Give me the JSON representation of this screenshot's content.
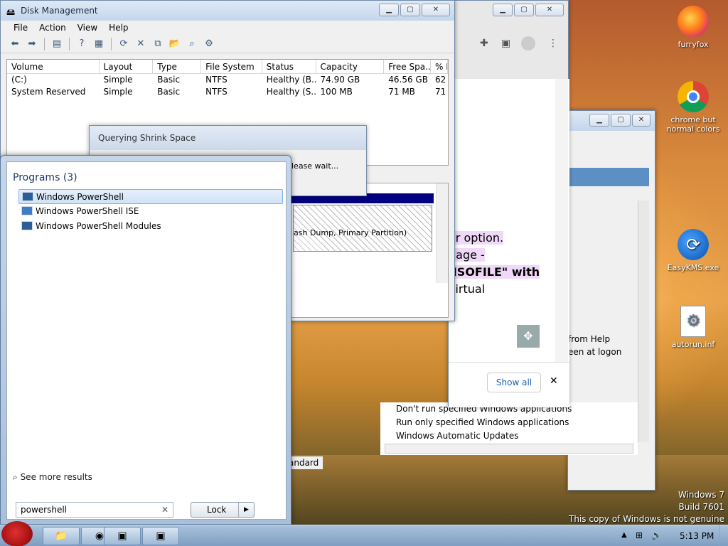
{
  "desktop": {
    "icons": [
      {
        "label": "furryfox",
        "icon": "firefox-icon"
      },
      {
        "label": "chrome but normal colors",
        "icon": "chrome-icon"
      },
      {
        "label": "EasyKMS.exe",
        "icon": "easykms-icon"
      },
      {
        "label": "autorun.inf",
        "icon": "inf-file-icon"
      }
    ],
    "watermark": {
      "line1": "Windows 7",
      "line2": "Build 7601",
      "line3": "This copy of Windows is not genuine"
    }
  },
  "disk_management": {
    "title": "Disk Management",
    "menu": [
      "File",
      "Action",
      "View",
      "Help"
    ],
    "columns": [
      "Volume",
      "Layout",
      "Type",
      "File System",
      "Status",
      "Capacity",
      "Free Spa...",
      "% F"
    ],
    "rows": [
      [
        "(C:)",
        "Simple",
        "Basic",
        "NTFS",
        "Healthy (B...",
        "74.90 GB",
        "46.56 GB",
        "62"
      ],
      [
        "System Reserved",
        "Simple",
        "Basic",
        "NTFS",
        "Healthy (S...",
        "100 MB",
        "71 MB",
        "71"
      ]
    ],
    "partition_label": "ash Dump, Primary Partition)"
  },
  "shrink_dialog": {
    "title": "Querying Shrink Space",
    "message": "lease wait..."
  },
  "browser": {
    "text_lines": [
      "or option.",
      "nage  -",
      "\\ISOFILE\" with",
      "virtual"
    ],
    "show_all": "Show all"
  },
  "group_policy": {
    "items": [
      "Don't run specified Windows applications",
      "Run only specified Windows applications",
      "Windows Automatic Updates"
    ],
    "side_text": [
      "from Help",
      "een at logon"
    ],
    "tab": "andard"
  },
  "start_menu": {
    "programs_header": "Programs (3)",
    "programs": [
      "Windows PowerShell",
      "Windows PowerShell ISE",
      "Windows PowerShell Modules"
    ],
    "see_more": "See more results",
    "search_value": "powershell",
    "lock_label": "Lock"
  },
  "taskbar": {
    "time": "5:13 PM"
  }
}
